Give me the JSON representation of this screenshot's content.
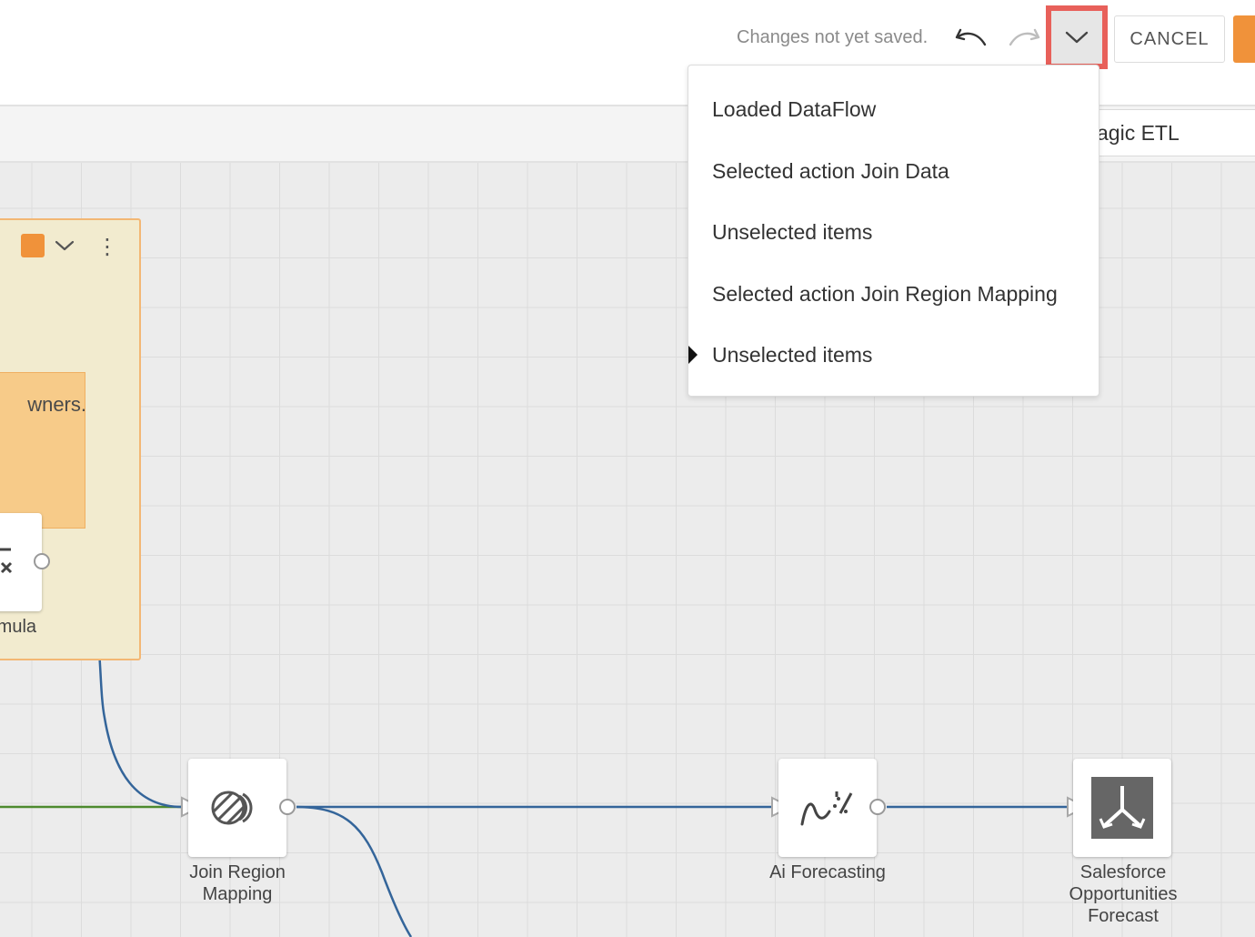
{
  "header": {
    "status": "Changes not yet saved.",
    "cancel_label": "CANCEL",
    "undo_icon": "undo-icon",
    "redo_icon": "redo-icon",
    "history_icon": "chevron-down-icon"
  },
  "name_field": {
    "value": "agic ETL"
  },
  "history_menu": {
    "items": [
      "Loaded DataFlow",
      "Selected action Join Data",
      "Unselected items",
      "Selected action Join Region Mapping",
      "Unselected items"
    ],
    "current_index": 4
  },
  "canvas": {
    "group": {
      "color": "#f0923a",
      "note_text": "wners.",
      "formula_label": "rmula"
    },
    "tiles": {
      "join_region": {
        "label_line1": "Join Region",
        "label_line2": "Mapping"
      },
      "ai_forecasting": {
        "label": "Ai Forecasting"
      },
      "salesforce": {
        "label_line1": "Salesforce",
        "label_line2": "Opportunities",
        "label_line3": "Forecast"
      }
    },
    "colors": {
      "connector": "#34659a",
      "green_connector": "#4d8a2e",
      "accent": "#f0923a"
    }
  }
}
